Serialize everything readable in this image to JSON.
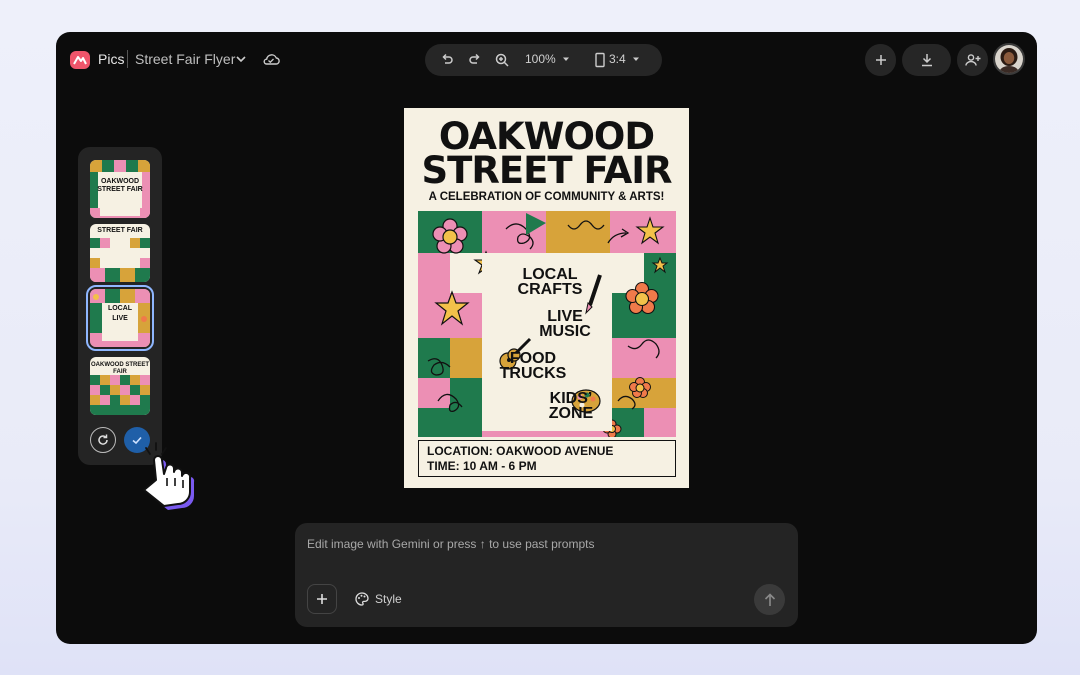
{
  "app": {
    "name": "Pics",
    "doc_title": "Street Fair Flyer"
  },
  "toolbar": {
    "zoom": "100%",
    "aspect_ratio": "3:4"
  },
  "poster": {
    "title_line1": "OAKWOOD",
    "title_line2": "STREET FAIR",
    "subtitle": "A CELEBRATION OF COMMUNITY & ARTS!",
    "features": [
      {
        "line1": "LOCAL",
        "line2": "CRAFTS"
      },
      {
        "line1": "LIVE",
        "line2": "MUSIC"
      },
      {
        "line1": "FOOD",
        "line2": "TRUCKS"
      },
      {
        "line1": "KIDS’",
        "line2": "ZONE"
      }
    ],
    "location": "LOCATION: OAKWOOD AVENUE",
    "time": "TIME: 10 AM - 6 PM"
  },
  "thumbnails": [
    {
      "line1": "OAKWOOD",
      "line2": "STREET FAIR"
    },
    {
      "line1": "STREET FAIR",
      "line2": ""
    },
    {
      "line1": "LOCAL",
      "line2": "LIVE"
    },
    {
      "line1": "OAKWOOD STREET FAIR",
      "line2": ""
    }
  ],
  "prompt": {
    "placeholder": "Edit image with Gemini or press ↑ to use past prompts",
    "style_label": "Style"
  },
  "colors": {
    "window_bg": "#0c0c0c",
    "panel_bg": "#242424",
    "pink": "#ec8fb4",
    "green": "#1f7a4d",
    "mustard": "#d7a33a",
    "accept_blue": "#1f5fa8"
  }
}
